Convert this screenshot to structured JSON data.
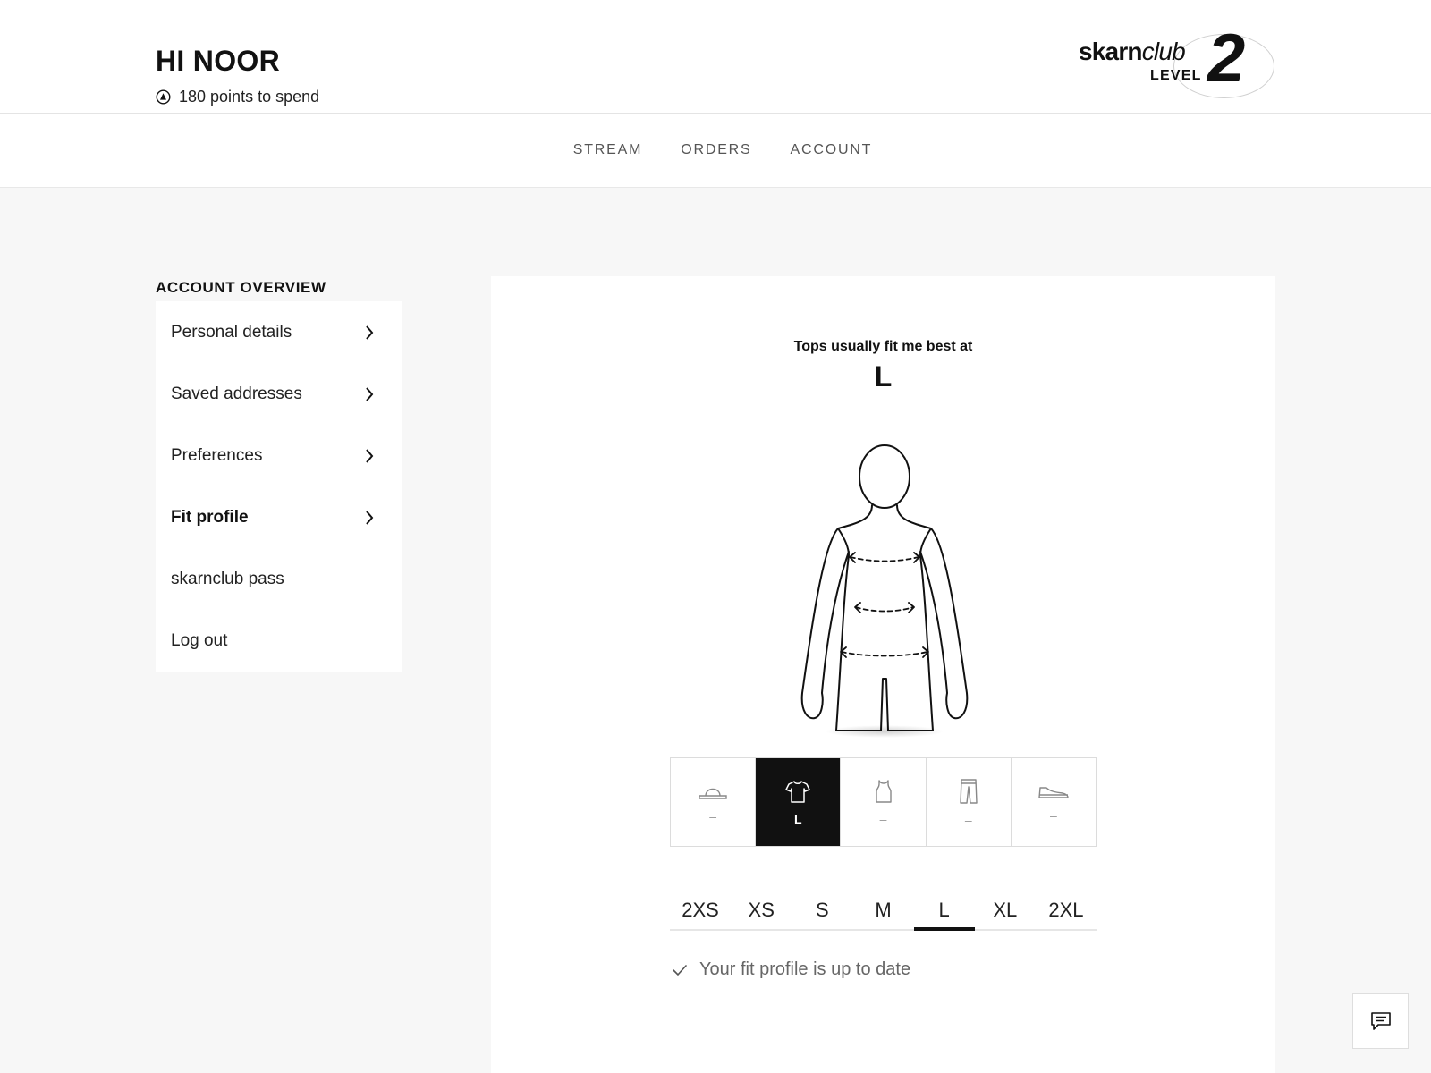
{
  "header": {
    "greeting": "HI NOOR",
    "points_text": "180 points to spend",
    "points_icon": "arrow-up-circle-icon",
    "club": {
      "brand_strong": "skarn",
      "brand_italic": "club",
      "level_word": "LEVEL",
      "level_number": "2"
    }
  },
  "nav": {
    "items": [
      {
        "label": "STREAM"
      },
      {
        "label": "ORDERS"
      },
      {
        "label": "ACCOUNT"
      }
    ]
  },
  "sidebar": {
    "title": "ACCOUNT OVERVIEW",
    "items": [
      {
        "label": "Personal details",
        "chevron": true,
        "active": false
      },
      {
        "label": "Saved addresses",
        "chevron": true,
        "active": false
      },
      {
        "label": "Preferences",
        "chevron": true,
        "active": false
      },
      {
        "label": "Fit profile",
        "chevron": true,
        "active": true
      },
      {
        "label": "skarnclub pass",
        "chevron": false,
        "active": false
      },
      {
        "label": "Log out",
        "chevron": false,
        "active": false
      }
    ]
  },
  "fit": {
    "title": "Tops usually fit me best at",
    "selected_size": "L",
    "categories": [
      {
        "icon": "hat-icon",
        "value": "–",
        "active": false
      },
      {
        "icon": "tshirt-icon",
        "value": "L",
        "active": true
      },
      {
        "icon": "tank-top-icon",
        "value": "–",
        "active": false
      },
      {
        "icon": "trousers-icon",
        "value": "–",
        "active": false
      },
      {
        "icon": "sneaker-icon",
        "value": "–",
        "active": false
      }
    ],
    "sizes": [
      "2XS",
      "XS",
      "S",
      "M",
      "L",
      "XL",
      "2XL"
    ],
    "active_size_index": 4,
    "status_text": "Your fit profile is up to date",
    "status_icon": "checkmark-icon"
  },
  "chat": {
    "icon": "chat-icon"
  },
  "colors": {
    "accent": "#111111",
    "background": "#f7f7f7",
    "surface": "#ffffff",
    "muted_text": "#666666"
  }
}
